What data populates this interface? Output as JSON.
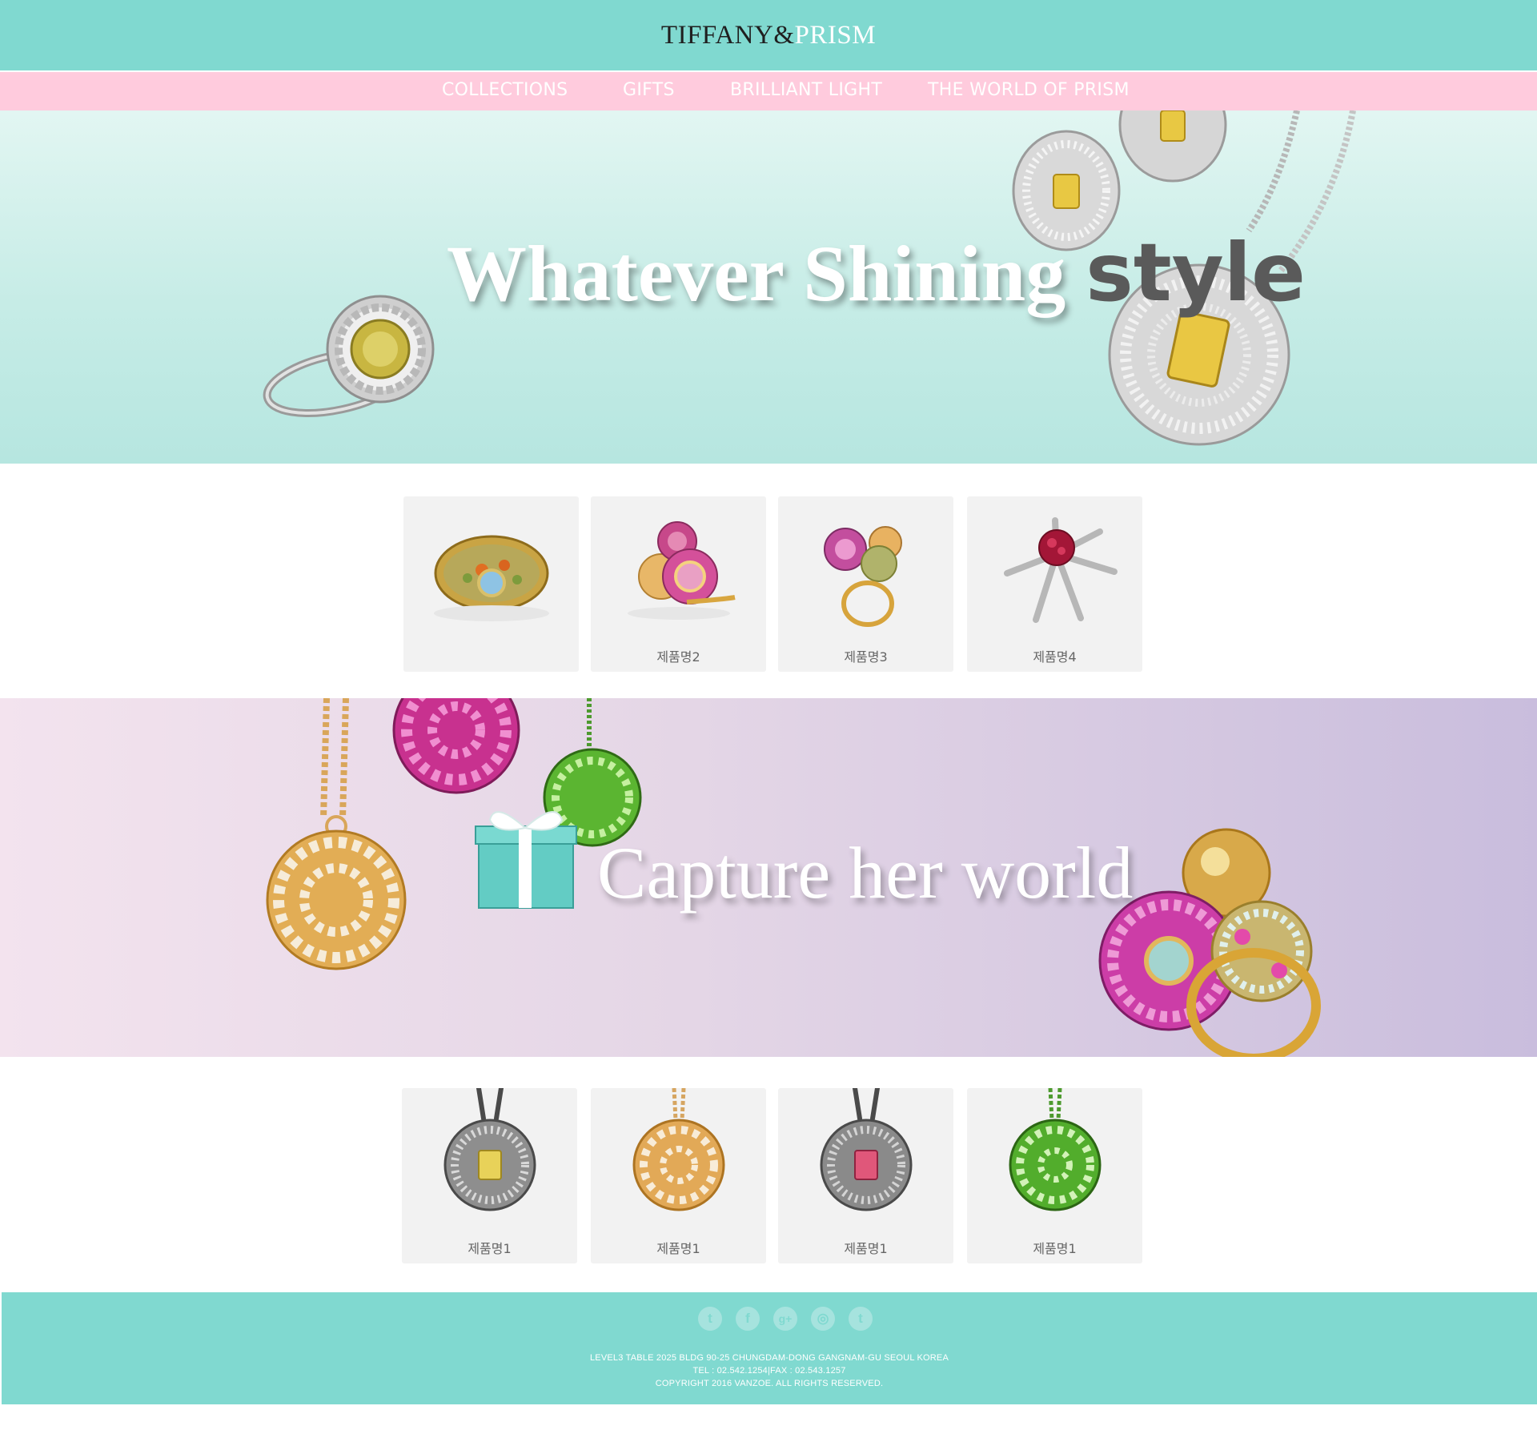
{
  "header": {
    "logo_left": "TIFFANY&",
    "logo_right": "PRISM",
    "bg_color": "#80d9d0"
  },
  "nav": {
    "items": [
      "COLLECTIONS",
      "GIFTS",
      "BRILLIANT LIGHT",
      "THE WORLD OF PRISM"
    ],
    "bg_color": "#ffcbdd"
  },
  "hero1": {
    "title_main": "Whatever Shining ",
    "title_accent": "style"
  },
  "products_top": {
    "items": [
      {
        "name": "",
        "icon": "gold-ring-icon"
      },
      {
        "name": "제품명2",
        "icon": "pink-sphere-ring-icon"
      },
      {
        "name": "제품명3",
        "icon": "double-sphere-ring-icon"
      },
      {
        "name": "제품명4",
        "icon": "star-brooch-icon"
      }
    ]
  },
  "hero2": {
    "title": "Capture her world"
  },
  "products_bottom": {
    "items": [
      {
        "name": "제품명1",
        "icon": "yellow-diamond-pendant-icon"
      },
      {
        "name": "제품명1",
        "icon": "gold-sphere-pendant-icon"
      },
      {
        "name": "제품명1",
        "icon": "pink-diamond-pendant-icon"
      },
      {
        "name": "제품명1",
        "icon": "green-sphere-pendant-icon"
      }
    ]
  },
  "footer": {
    "social": [
      "twitter-icon",
      "facebook-icon",
      "google-plus-icon",
      "instagram-icon",
      "tumblr-icon"
    ],
    "social_glyphs": [
      "t",
      "f",
      "g+",
      "◎",
      "t"
    ],
    "address": "LEVEL3 TABLE 2025 BLDG 90-25 CHUNGDAM-DONG GANGNAM-GU SEOUL KOREA",
    "tel": "TEL : 02.542.1254|FAX : 02.543.1257",
    "copyright": "COPYRIGHT 2016 VANZOE. ALL RIGHTS RESERVED."
  }
}
